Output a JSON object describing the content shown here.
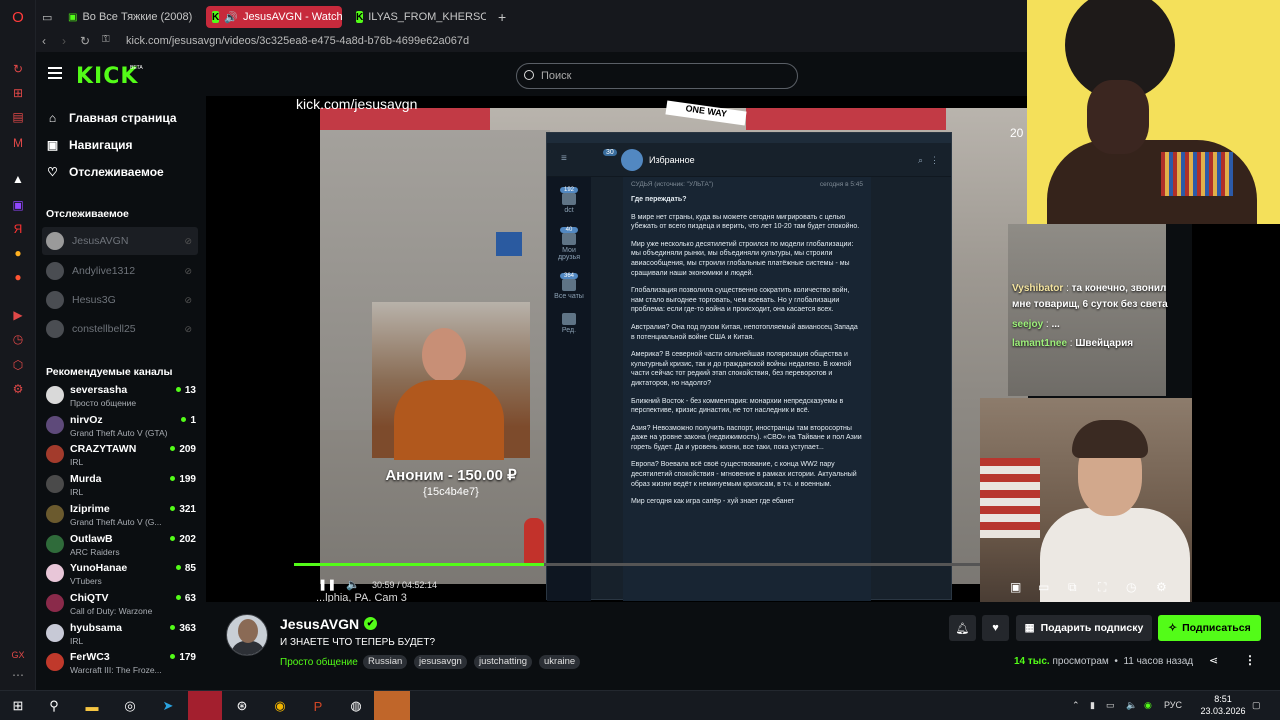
{
  "browser": {
    "tabs": [
      {
        "label": "Во Все Тяжкие (2008) Смотре..."
      },
      {
        "label": "JesusAVGN - Watch the"
      },
      {
        "label": "ILYAS_FROM_KHERSON S"
      }
    ],
    "new_tab": "+",
    "url": "kick.com/jesusavgn/videos/3c325ea8-e475-4a8d-b76b-4699e62a067d"
  },
  "kick": {
    "logo": "KICK",
    "logo_badge": "BETA",
    "search_placeholder": "Поиск",
    "nav": [
      {
        "label": "Главная страница",
        "icon": "home-icon"
      },
      {
        "label": "Навигация",
        "icon": "compass-icon"
      },
      {
        "label": "Отслеживаемое",
        "icon": "heart-icon"
      }
    ],
    "following_title": "Отслеживаемое",
    "following": [
      {
        "name": "JesusAVGN"
      },
      {
        "name": "Andylive1312"
      },
      {
        "name": "Hesus3G"
      },
      {
        "name": "constellbell25"
      }
    ],
    "recommended_title": "Рекомендуемые каналы",
    "recommended": [
      {
        "name": "seversasha",
        "game": "Просто общение",
        "viewers": "13",
        "color": "#d9d9d9"
      },
      {
        "name": "nirvOz",
        "game": "Grand Theft Auto V (GTA)",
        "viewers": "1",
        "color": "#5e4a7a"
      },
      {
        "name": "CRAZYTAWN",
        "game": "IRL",
        "viewers": "209",
        "color": "#a33b2c"
      },
      {
        "name": "Murda",
        "game": "IRL",
        "viewers": "199",
        "color": "#4a4a4a"
      },
      {
        "name": "Iziprime",
        "game": "Grand Theft Auto V (G...",
        "viewers": "321",
        "color": "#6b5a2e"
      },
      {
        "name": "OutlawB",
        "game": "ARC Raiders",
        "viewers": "202",
        "color": "#2f6b3a"
      },
      {
        "name": "YunoHanae",
        "game": "VTubers",
        "viewers": "85",
        "color": "#e8c6d8"
      },
      {
        "name": "ChiQTV",
        "game": "Call of Duty: Warzone",
        "viewers": "63",
        "color": "#8a2a4a"
      },
      {
        "name": "hyubsama",
        "game": "IRL",
        "viewers": "363",
        "color": "#c7c9d6"
      },
      {
        "name": "FerWC3",
        "game": "Warcraft III: The Froze...",
        "viewers": "179",
        "color": "#c0392b"
      }
    ]
  },
  "video": {
    "overlay_url": "kick.com/jesusavgn",
    "sign": "ONE WAY",
    "side_number": "20",
    "telegram": {
      "title": "Избранное",
      "badge": "30",
      "folders": [
        {
          "badge": "192",
          "label": "dct"
        },
        {
          "badge": "40",
          "label": "Мои друзья"
        },
        {
          "badge": "364",
          "label": "Все чаты"
        },
        {
          "badge": "",
          "label": "Ред."
        }
      ],
      "source": "СУДЬЯ (источник: \"УЛЬТА\")",
      "time": "сегодня в 5:45",
      "paragraphs": [
        "Где переждать?",
        "В мире нет страны, куда вы можете сегодня мигрировать с целью убежать от всего пиздеца и верить, что лет 10-20 там будет спокойно.",
        "Мир уже несколько десятилетий строился по модели глобализации: мы объединяли рынки, мы объединяли культуры, мы строили авиасообщения, мы строили глобальные платёжные системы - мы сращивали наши экономики и людей.",
        "Глобализация позволила существенно сократить количество войн, нам стало выгоднее торговать, чем воевать. Но у глобализации проблема: если где-то война и происходит, она касается всех.",
        "Австралия? Она под пузом Китая, непотопляемый авианосец Запада в потенциальной войне США и Китая.",
        "Америка? В северной части сильнейшая поляризация общества и культурный кризис, так и до гражданской войны недалеко. В южной части сейчас тот редкий этап спокойствия, без переворотов и диктаторов, но надолго?",
        "Ближний Восток - без комментария: монархии непредсказуемы в перспективе, кризис династии, не тот наследник и всё.",
        "Азия? Невозможно получить паспорт, иностранцы там второсортны даже на уровне закона (недвижимость). «СВО» на Тайване и пол Азии гореть будет. Да и уровень жизни, все таки, пока уступает...",
        "Европа? Воевала всё своё существование, с конца WW2 пару десятилетий спокойствия - мгновение в рамках истории. Актуальный образ жизни ведёт к неминуемым кризисам, в т.ч. и военным.",
        "Мир сегодня как игра сапёр - хуй знает где ебанет"
      ]
    },
    "donation": {
      "text": "Аноним - 150.00 ₽",
      "code": "{15c4b4e7}"
    },
    "time": "30:59 / 04:52:14",
    "progress": 0.34,
    "cam_label": "...lphia, PA. Cam 3",
    "chat": [
      {
        "user": "Vyshibator",
        "msg": "та конечно, звонил"
      },
      {
        "user": "",
        "msg": "мне товарищ, 6 суток без света"
      },
      {
        "user": "seejoy",
        "msg": "..."
      },
      {
        "user": "lamant1nee",
        "msg": "Швейцария"
      }
    ]
  },
  "channel": {
    "name": "JesusAVGN",
    "verified": "✔",
    "title": "И ЗНАЕТЕ ЧТО ТЕПЕРЬ БУДЕТ?",
    "category": "Просто общение",
    "tags": [
      "Russian",
      "jesusavgn",
      "justchatting",
      "ukraine"
    ],
    "gift_label": "Подарить подписку",
    "subscribe_label": "Подписаться",
    "views_count": "14 тыс.",
    "views_label": "просмотрам",
    "ago": "11 часов назад"
  },
  "taskbar": {
    "lang": "РУС",
    "time": "8:51",
    "date": "23.03.2026"
  },
  "colors": {
    "accent": "#53fc18",
    "tab_active": "#c72a3c",
    "bg": "#0b0e11"
  }
}
